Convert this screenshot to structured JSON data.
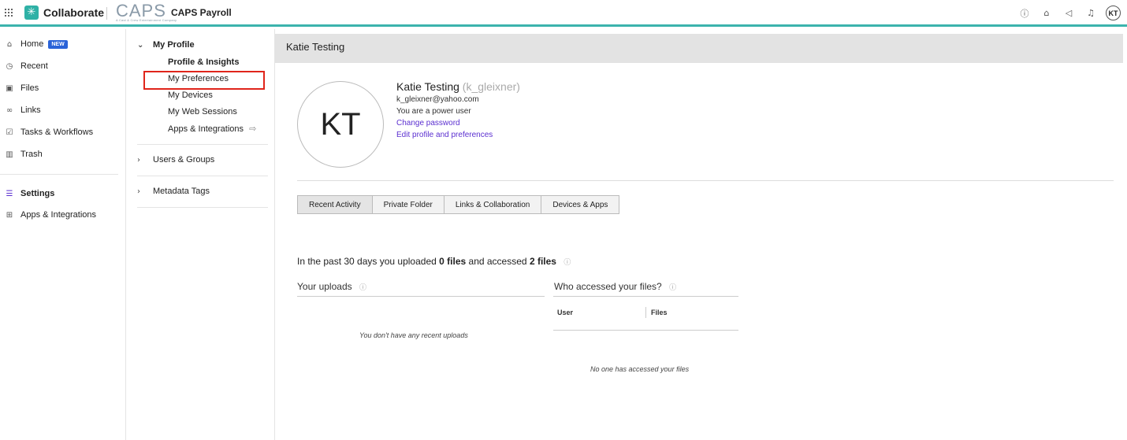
{
  "topbar": {
    "brand_name": "Collaborate",
    "caps_logo": "CAPS",
    "caps_logo_sub": "A Cast & Crew Entertainment Company",
    "company_name": "CAPS Payroll",
    "icons": [
      "help-icon",
      "graduation-cap-icon",
      "megaphone-icon",
      "bell-icon"
    ],
    "avatar_initials": "KT"
  },
  "leftnav": {
    "items": [
      {
        "label": "Home",
        "icon": "home-icon",
        "badge": "NEW"
      },
      {
        "label": "Recent",
        "icon": "clock-icon"
      },
      {
        "label": "Files",
        "icon": "files-icon"
      },
      {
        "label": "Links",
        "icon": "link-icon"
      },
      {
        "label": "Tasks & Workflows",
        "icon": "tasks-icon"
      },
      {
        "label": "Trash",
        "icon": "trash-icon"
      },
      {
        "label": "Settings",
        "icon": "settings-sliders-icon"
      },
      {
        "label": "Apps & Integrations",
        "icon": "apps-icon"
      }
    ]
  },
  "subnav": {
    "my_profile": "My Profile",
    "items": [
      "Profile & Insights",
      "My Preferences",
      "My Devices",
      "My Web Sessions",
      "Apps & Integrations"
    ],
    "users_groups": "Users & Groups",
    "metadata_tags": "Metadata Tags"
  },
  "main": {
    "header": "Katie Testing",
    "initials": "KT",
    "name": "Katie Testing",
    "username": "(k_gleixner)",
    "email": "k_gleixner@yahoo.com",
    "role": "You are a power user",
    "change_password": "Change password",
    "edit_profile": "Edit profile and preferences",
    "tabs": [
      "Recent Activity",
      "Private Folder",
      "Links & Collaboration",
      "Devices & Apps"
    ],
    "summary": {
      "prefix": "In the past 30 days you uploaded",
      "uploaded": "0 files",
      "middle": "and accessed",
      "accessed": "2 files"
    },
    "uploads_title": "Your uploads",
    "uploads_empty": "You don't have any recent uploads",
    "accessed_title": "Who accessed your files?",
    "accessed_headers": [
      "User",
      "Files"
    ],
    "accessed_empty": "No one has accessed your files"
  }
}
